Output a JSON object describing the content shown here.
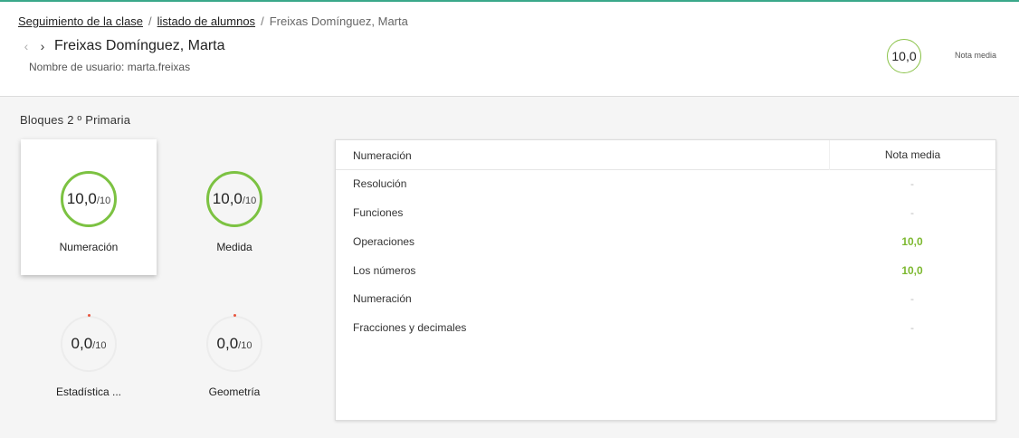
{
  "breadcrumb": {
    "items": [
      "Seguimiento de la clase",
      "listado de alumnos"
    ],
    "separator": "/",
    "current": "Freixas Domínguez, Marta"
  },
  "nav": {
    "prev_icon": "chevron-left-icon",
    "next_icon": "chevron-right-icon",
    "prev": "‹",
    "next": "›"
  },
  "student": {
    "name": "Freixas Domínguez, Marta",
    "username_line": "Nombre de usuario: marta.freixas"
  },
  "average": {
    "value": "10,0",
    "label": "Nota media",
    "color": "#8bc34a"
  },
  "section_title": "Bloques 2 º Primaria",
  "blocks": [
    {
      "label": "Numeración",
      "score": "10,0",
      "max": "/10",
      "progress": 1.0,
      "selected": true
    },
    {
      "label": "Medida",
      "score": "10,0",
      "max": "/10",
      "progress": 1.0,
      "selected": false
    },
    {
      "label": "Estadística ...",
      "score": "0,0",
      "max": "/10",
      "progress": 0.0,
      "selected": false
    },
    {
      "label": "Geometría",
      "score": "0,0",
      "max": "/10",
      "progress": 0.0,
      "selected": false
    }
  ],
  "table": {
    "headers": [
      "Numeración",
      "Nota media"
    ],
    "rows": [
      {
        "name": "Resolución",
        "grade": "-"
      },
      {
        "name": "Funciones",
        "grade": "-"
      },
      {
        "name": "Operaciones",
        "grade": "10,0"
      },
      {
        "name": "Los números",
        "grade": "10,0"
      },
      {
        "name": "Numeración",
        "grade": "-"
      },
      {
        "name": "Fracciones y decimales",
        "grade": "-"
      }
    ]
  },
  "colors": {
    "accent": "#3aa88a",
    "good": "#7cb82f",
    "ring_full": "#7cc242",
    "ring_empty": "#ececec",
    "empty_dot": "#e8553e"
  }
}
